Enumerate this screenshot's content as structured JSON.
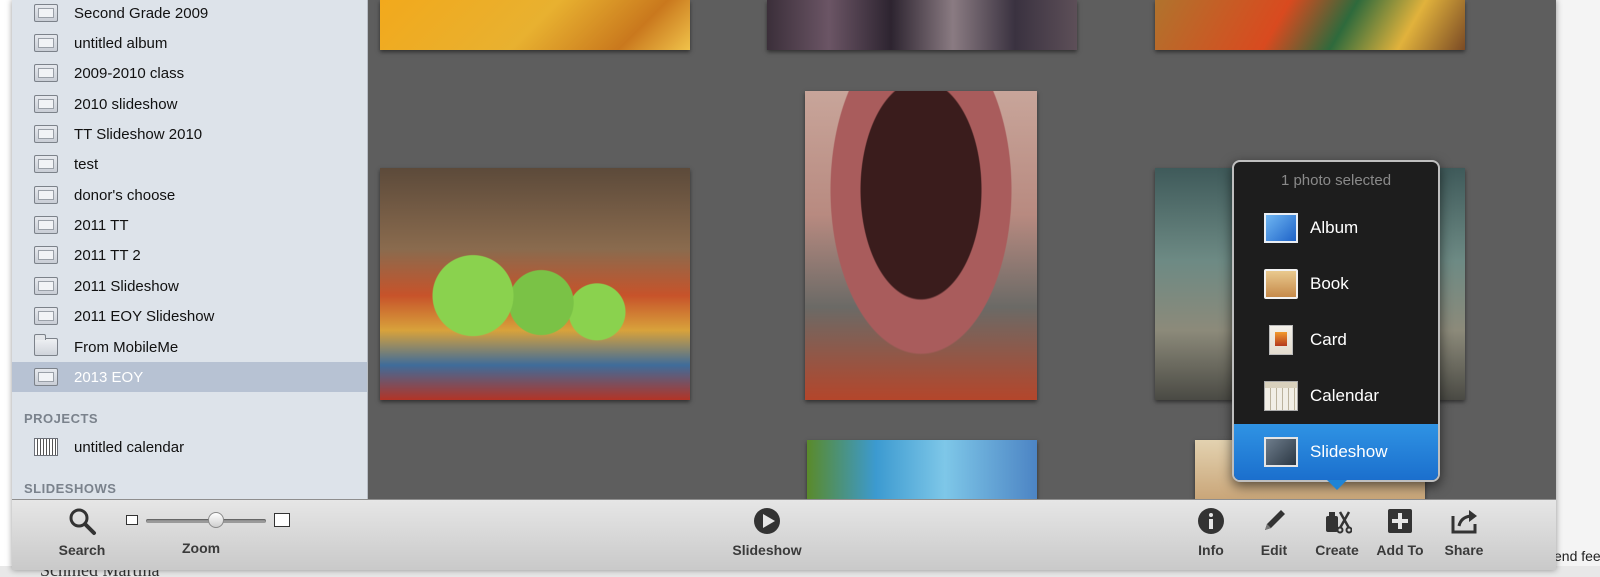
{
  "sidebar": {
    "albums": [
      {
        "label": "Second Grade 2009",
        "icon": "album-icon"
      },
      {
        "label": "untitled album",
        "icon": "album-icon"
      },
      {
        "label": "2009-2010 class",
        "icon": "album-icon"
      },
      {
        "label": "2010 slideshow",
        "icon": "album-icon"
      },
      {
        "label": "TT Slideshow 2010",
        "icon": "album-icon"
      },
      {
        "label": "test",
        "icon": "album-icon"
      },
      {
        "label": "donor's choose",
        "icon": "album-icon"
      },
      {
        "label": "2011 TT",
        "icon": "album-icon"
      },
      {
        "label": "2011 TT 2",
        "icon": "album-icon"
      },
      {
        "label": "2011 Slideshow",
        "icon": "album-icon"
      },
      {
        "label": "2011 EOY Slideshow",
        "icon": "album-icon"
      },
      {
        "label": "From MobileMe",
        "icon": "folder-icon"
      },
      {
        "label": "2013 EOY",
        "icon": "album-icon",
        "selected": true
      }
    ],
    "projects_header": "PROJECTS",
    "projects": [
      {
        "label": "untitled calendar",
        "icon": "calendar-icon"
      }
    ],
    "slideshows_header": "SLIDESHOWS"
  },
  "popup": {
    "title": "1 photo selected",
    "items": [
      {
        "label": "Album",
        "icon": "album-icon"
      },
      {
        "label": "Book",
        "icon": "book-icon"
      },
      {
        "label": "Card",
        "icon": "card-icon"
      },
      {
        "label": "Calendar",
        "icon": "calendar-icon"
      },
      {
        "label": "Slideshow",
        "icon": "slideshow-icon",
        "highlighted": true
      }
    ],
    "highlight_color": "#1f84d6"
  },
  "toolbar": {
    "search_label": "Search",
    "zoom_label": "Zoom",
    "zoom_level": 0.58,
    "slideshow_label": "Slideshow",
    "info_label": "Info",
    "edit_label": "Edit",
    "create_label": "Create",
    "add_to_label": "Add To",
    "share_label": "Share"
  },
  "background": {
    "right_text": "end fee",
    "bottom_text": "Schmed  Martina"
  },
  "colors": {
    "sidebar_bg": "#dde3ea",
    "sidebar_selected": "#b7c2d3",
    "grid_bg": "#5e5e5e",
    "popup_bg": "#1d1d1d"
  }
}
